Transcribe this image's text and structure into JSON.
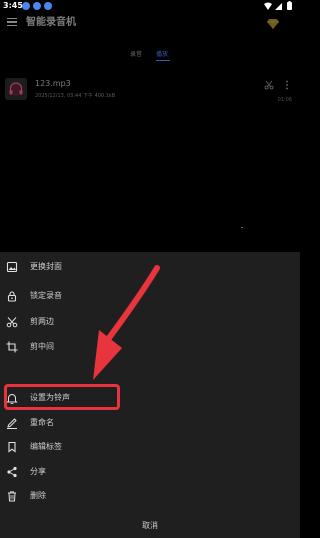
{
  "status_bar": {
    "time": "3:45"
  },
  "app": {
    "title": "智能录音机"
  },
  "tabs": [
    {
      "label": "录音",
      "active": false
    },
    {
      "label": "播放",
      "active": true
    }
  ],
  "file": {
    "name": "123.mp3",
    "meta": "2025/12/13, 03:44 下午    400.1kB",
    "duration": "01:06"
  },
  "menu": {
    "items": [
      {
        "icon": "image-icon",
        "label": "更换封面"
      },
      {
        "icon": "lock-icon",
        "label": "锁定录音"
      },
      {
        "icon": "scissors-icon",
        "label": "剪两边"
      },
      {
        "icon": "crop-icon",
        "label": "剪中间"
      },
      {
        "icon": "bell-icon",
        "label": "设置为铃声"
      },
      {
        "icon": "pencil-icon",
        "label": "重命名"
      },
      {
        "icon": "bookmark-icon",
        "label": "编辑标签"
      },
      {
        "icon": "share-icon",
        "label": "分享"
      },
      {
        "icon": "trash-icon",
        "label": "删除"
      }
    ],
    "cancel_label": "取消"
  },
  "colors": {
    "accent": "#2d5fb8",
    "highlight": "#e8343d",
    "sheet_background": "#1f1f1f",
    "notification": "#4a86f0"
  }
}
